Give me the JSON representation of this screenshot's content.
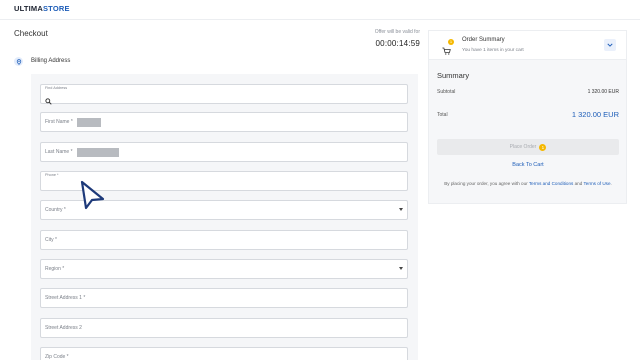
{
  "header": {
    "logo_prefix": "ULTIMA",
    "logo_suffix": "STORE"
  },
  "checkout": {
    "title": "Checkout",
    "offer_label": "Offer will be valid for",
    "offer_timer": "00:00:14:59"
  },
  "billing": {
    "title": "Billing Address",
    "fields": [
      {
        "label": "Find Address",
        "value": ""
      },
      {
        "label": "First Name *",
        "value": ""
      },
      {
        "label": "Last Name *",
        "value": ""
      },
      {
        "label": "Phone *",
        "value": ""
      },
      {
        "label": "Country *",
        "value": ""
      },
      {
        "label": "City *",
        "value": ""
      },
      {
        "label": "Region *",
        "value": ""
      },
      {
        "label": "Street Address 1 *",
        "value": ""
      },
      {
        "label": "Street Address 2",
        "value": ""
      },
      {
        "label": "Zip Code *",
        "value": ""
      }
    ]
  },
  "order_summary": {
    "title": "Order Summary",
    "subtitle": "You have 1 items in your cart",
    "cart_count": "1"
  },
  "summary": {
    "title": "Summary",
    "subtotal_label": "Subtotal",
    "subtotal_value": "1 320.00 EUR",
    "total_label": "Total",
    "total_value": "1 320.00 EUR",
    "place_order_label": "Place Order",
    "place_order_badge": "1",
    "back_to_cart": "Back To Cart",
    "legal_prefix": "By placing your order, you agree with our ",
    "legal_terms": "Terms and Conditions",
    "legal_and": " and ",
    "legal_terms_of_use": "Terms of Use",
    "legal_suffix": "."
  },
  "icons": {
    "logo": "brand-wordmark",
    "billing": "location-pin-icon",
    "search": "search-icon",
    "dropdown": "chevron-down-icon",
    "cart": "cart-icon",
    "expand": "chevron-down-icon",
    "pointer": "mouse-cursor-icon"
  },
  "colors": {
    "accent": "#1d5db8",
    "badge": "#f5b800",
    "panel": "#f5f6f8",
    "border": "#d6d9de"
  }
}
